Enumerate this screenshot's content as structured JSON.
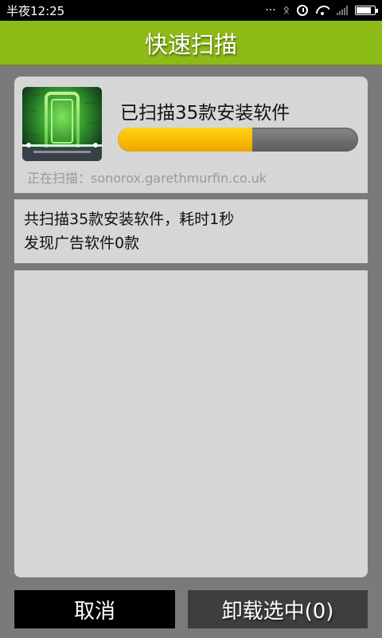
{
  "status_bar": {
    "time": "半夜12:25",
    "icons": [
      "dots-icon",
      "bluetooth-icon",
      "alarm-icon",
      "wifi-icon",
      "signal-icon",
      "battery-icon"
    ]
  },
  "header": {
    "title": "快速扫描"
  },
  "scan_panel": {
    "app_icon": "scanner-app-icon",
    "title": "已扫描35款安装软件",
    "progress_fraction": 0.56,
    "current_label": "正在扫描：sonorox.garethmurfin.co.uk"
  },
  "summary": {
    "line1": "共扫描35款安装软件，耗时1秒",
    "line2": "发现广告软件0款"
  },
  "buttons": {
    "cancel": "取消",
    "uninstall": "卸载选中(0)"
  },
  "colors": {
    "header_bg": "#8cba17",
    "progress_fill": "#f7b800",
    "progress_track": "#6c6c6c",
    "panel_bg": "#d6d6d6"
  }
}
